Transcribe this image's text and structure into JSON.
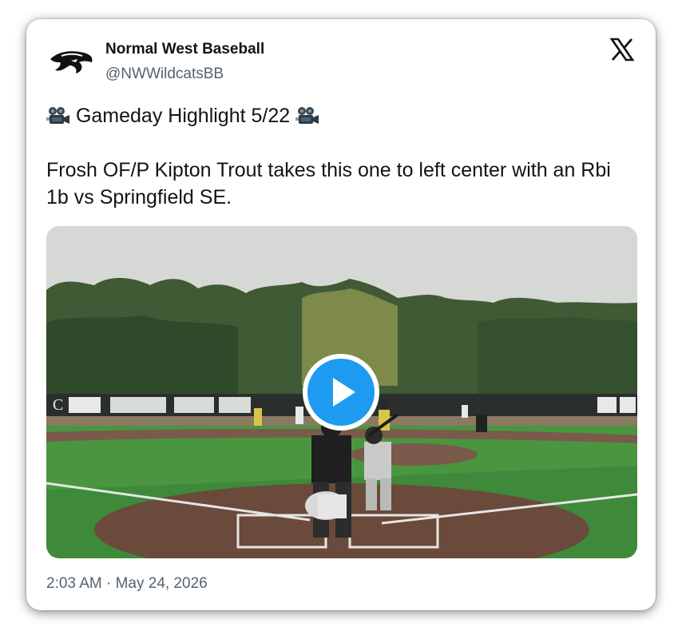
{
  "author": {
    "name": "Normal West Baseball",
    "handle": "@NWWildcatsBB",
    "avatar_icon": "wildcat-logo-icon"
  },
  "brand": {
    "logo_icon": "x-logo-icon",
    "accent": "#1d9bf0"
  },
  "tweet": {
    "title_line": "Gameday Highlight 5/22",
    "title_emoji_icon": "movie-camera-icon",
    "body": "Frosh OF/P Kipton Trout takes this one to left center with an Rbi 1b vs Springfield SE."
  },
  "media": {
    "type": "video",
    "play_icon": "play-icon",
    "description_icon": "baseball-field-scene"
  },
  "timestamp": "2:03 AM · May 24, 2026"
}
